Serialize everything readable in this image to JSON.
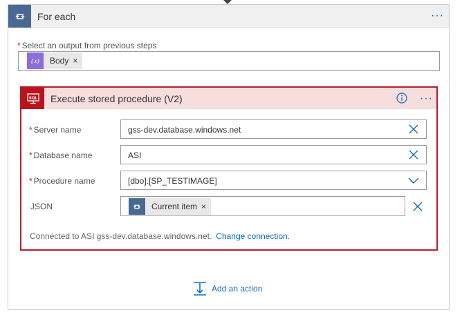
{
  "colors": {
    "accent_blue": "#0f6cbd",
    "foreach_icon_bg": "#486991",
    "sql_icon_bg": "#ba141a",
    "error_border": "#b41d2b",
    "error_header_bg": "#f6dede"
  },
  "foreach": {
    "title": "For each",
    "icon": "loop-icon",
    "menu_icon": "more-dots-icon",
    "output_label": "Select an output from previous steps",
    "required_mark": "*",
    "output_token": {
      "label": "Body",
      "icon": "expression-icon",
      "remove_glyph": "×"
    }
  },
  "action": {
    "title": "Execute stored procedure (V2)",
    "icon": "sql-icon",
    "info_icon": "info-icon",
    "menu_icon": "more-dots-icon",
    "fields": [
      {
        "label": "Server name",
        "required": true,
        "value": "gss-dev.database.windows.net",
        "control": "clear-icon"
      },
      {
        "label": "Database name",
        "required": true,
        "value": "ASI",
        "control": "clear-icon"
      },
      {
        "label": "Procedure name",
        "required": true,
        "value": "[dbo].[SP_TESTIMAGE]",
        "control": "chevron-down-icon"
      },
      {
        "label": "JSON",
        "required": false,
        "value": "",
        "control": "clear-icon",
        "token": {
          "label": "Current item",
          "icon": "loop-icon",
          "remove_glyph": "×"
        }
      }
    ],
    "connection_text": "Connected to ASI gss-dev.database.windows.net.",
    "change_connection": "Change connection."
  },
  "add_action": {
    "label": "Add an action",
    "icon": "add-action-icon"
  }
}
